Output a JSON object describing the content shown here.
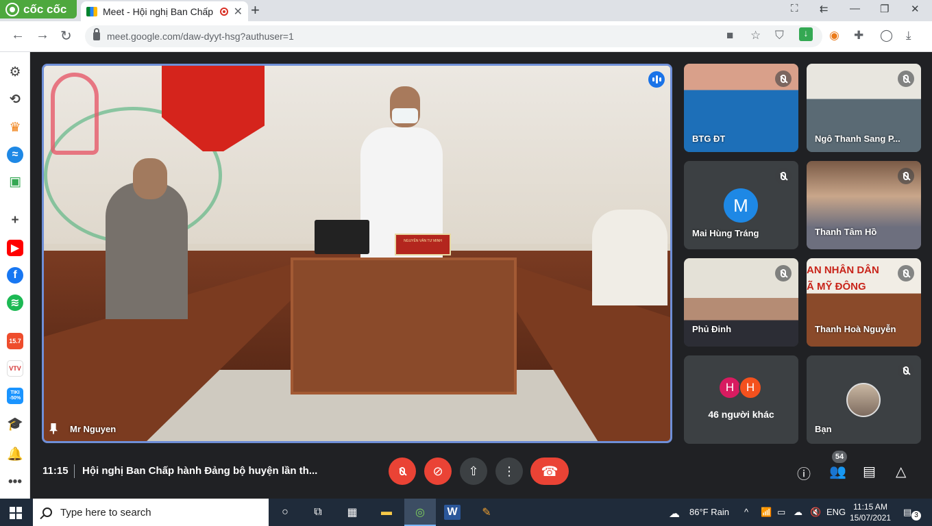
{
  "browser": {
    "brand": "cốc cốc",
    "tab_title": "Meet - Hội nghị Ban Chấp",
    "url": "meet.google.com/daw-dyyt-hsg?authuser=1"
  },
  "sidebar": {
    "badges": {
      "shopee": "15.7",
      "tiki": "TIKI -50%",
      "vtv": "VTV"
    }
  },
  "meeting": {
    "main_speaker": "Mr Nguyen",
    "nameplate": "NGUYỄN VĂN TƯ MINH",
    "time": "11:15",
    "title": "Hội nghị Ban Chấp hành Đảng bộ huyện lần th...",
    "participants_count": "54",
    "tiles": [
      {
        "name": "BTG ĐT"
      },
      {
        "name": "Ngô Thanh Sang P..."
      },
      {
        "name": "Mai Hùng Tráng",
        "initial": "M"
      },
      {
        "name": "Thanh Tâm Hồ"
      },
      {
        "name": "Phủ Đinh"
      },
      {
        "name": "Thanh Hoà Nguyễn",
        "banner_line1": "AN NHÂN DÂN",
        "banner_line2": "Ã MỸ ĐÔNG"
      },
      {
        "name": "46 người khác",
        "initials": [
          "H",
          "H"
        ]
      },
      {
        "name": "Bạn"
      }
    ]
  },
  "taskbar": {
    "search_placeholder": "Type here to search",
    "weather": "86°F  Rain",
    "language": "ENG",
    "time": "11:15 AM",
    "date": "15/07/2021",
    "notifications": "3"
  },
  "colors": {
    "accent": "#1a73e8",
    "danger": "#ea4335",
    "surface": "#3c4043",
    "brand": "#4ea83e"
  }
}
